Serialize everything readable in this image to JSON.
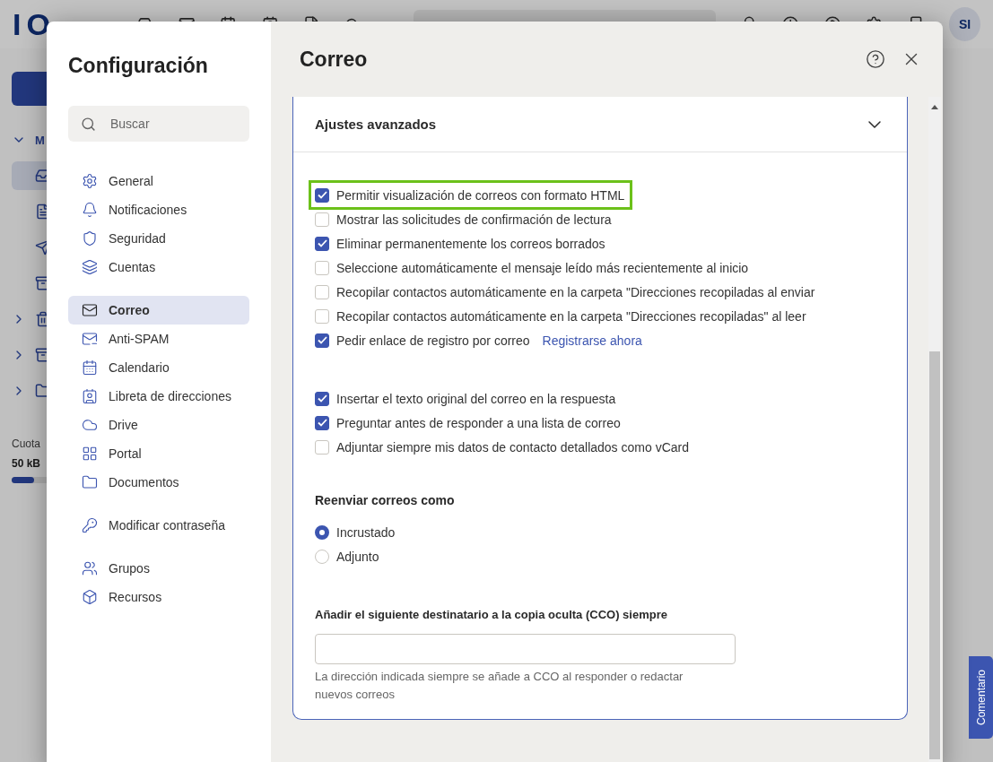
{
  "background_app": {
    "logo": "IO",
    "avatar": "SI",
    "folder_label": "M",
    "quota_label": "Cuota",
    "quota_value": "50 kB",
    "quota": {
      "level": 0.1
    },
    "feedback_button": "Comentario"
  },
  "settings": {
    "title": "Configuración",
    "search": {
      "placeholder": "Buscar"
    },
    "nav_groups": [
      [
        {
          "label": "General",
          "selected": false
        },
        {
          "label": "Notificaciones",
          "selected": false
        },
        {
          "label": "Seguridad",
          "selected": false
        },
        {
          "label": "Cuentas",
          "selected": false
        }
      ],
      [
        {
          "label": "Correo",
          "selected": true
        },
        {
          "label": "Anti-SPAM",
          "selected": false
        },
        {
          "label": "Calendario",
          "selected": false
        },
        {
          "label": "Libreta de direcciones",
          "selected": false
        },
        {
          "label": "Drive",
          "selected": false
        },
        {
          "label": "Portal",
          "selected": false
        },
        {
          "label": "Documentos",
          "selected": false
        }
      ],
      [
        {
          "label": "Modificar contraseña",
          "selected": false
        }
      ],
      [
        {
          "label": "Grupos",
          "selected": false
        },
        {
          "label": "Recursos",
          "selected": false
        }
      ]
    ]
  },
  "panel": {
    "title": "Correo",
    "section": {
      "title": "Ajustes avanzados",
      "expanded": true
    },
    "option_groups": [
      [
        {
          "label": "Permitir visualización de correos con formato HTML",
          "checked": true,
          "highlighted": true
        },
        {
          "label": "Mostrar las solicitudes de confirmación de lectura",
          "checked": false,
          "highlighted": false
        },
        {
          "label": "Eliminar permanentemente los correos borrados",
          "checked": true,
          "highlighted": false
        },
        {
          "label": "Seleccione automáticamente el mensaje leído más recientemente al inicio",
          "checked": false,
          "highlighted": false
        },
        {
          "label": "Recopilar contactos automáticamente en la carpeta \"Direcciones recopiladas al enviar",
          "checked": false,
          "highlighted": false
        },
        {
          "label": "Recopilar contactos automáticamente en la carpeta \"Direcciones recopiladas\" al leer",
          "checked": false,
          "highlighted": false
        },
        {
          "label": "Pedir enlace de registro por correo",
          "checked": true,
          "highlighted": false,
          "link": "Registrarse ahora"
        }
      ],
      [
        {
          "label": "Insertar el texto original del correo en la respuesta",
          "checked": true,
          "highlighted": false
        },
        {
          "label": "Preguntar antes de responder a una lista de correo",
          "checked": true,
          "highlighted": false
        },
        {
          "label": "Adjuntar siempre mis datos de contacto detallados como vCard",
          "checked": false,
          "highlighted": false
        }
      ]
    ],
    "forward": {
      "label": "Reenviar correos como",
      "options": [
        {
          "label": "Incrustado",
          "selected": true
        },
        {
          "label": "Adjunto",
          "selected": false
        }
      ]
    },
    "bcc": {
      "label": "Añadir el siguiente destinatario a la copia oculta (CCO) siempre",
      "hint": "La dirección indicada siempre se añade a CCO al responder o redactar nuevos correos"
    }
  }
}
